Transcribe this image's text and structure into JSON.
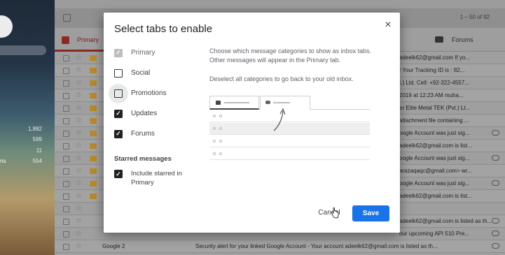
{
  "background": {
    "counts": [
      "1,882",
      "599",
      "11",
      "554"
    ],
    "left_label": "ns",
    "pager": "1 – 50 of 92",
    "tabs": {
      "primary": "Primary",
      "forums": "Forums"
    },
    "rows": [
      {
        "text": "adeelk62@gmail.com If yo..."
      },
      {
        "text": "! Your Tracking ID is : 82..."
      },
      {
        "text": "t.) Ltd. Cell: +92-322-4557..."
      },
      {
        "text": "2019 at 12:23 AM muha..."
      },
      {
        "text": "er Elite Metal TEK (Pvt.) Lt..."
      },
      {
        "text": "attachment file containing ..."
      },
      {
        "text": "oogle Account was just sig..."
      },
      {
        "text": "adeelk62@gmail.com is list..."
      },
      {
        "text": "oogle Account was just sig..."
      },
      {
        "text": "arazaqaqc@gmail.com> wr..."
      },
      {
        "text": "oogle Account was just sig..."
      },
      {
        "text": "adeelk62@gmail.com is list..."
      },
      {
        "text": ""
      },
      {
        "text": "adeelk62@gmail.com is listed as th..."
      },
      {
        "text": "our upcoming API 510 Pre..."
      },
      {
        "sender": "Google 2",
        "text": "Security alert for your linked Google Account - Your account adeelk62@gmail.com is listed as th..."
      },
      {
        "sender": "Google",
        "text": "Security alert - New device signed in to adeelk62@gmail.com Your Google Account was just sig..."
      }
    ]
  },
  "dialog": {
    "title": "Select tabs to enable",
    "close_label": "×",
    "options": [
      {
        "label": "Primary",
        "state": "disabled-checked"
      },
      {
        "label": "Social",
        "state": "unchecked"
      },
      {
        "label": "Promotions",
        "state": "focused-unchecked"
      },
      {
        "label": "Updates",
        "state": "checked"
      },
      {
        "label": "Forums",
        "state": "checked"
      }
    ],
    "starred_heading": "Starred messages",
    "starred_option": {
      "label": "Include starred in Primary",
      "checked": true
    },
    "description_1": "Choose which message categories to show as inbox tabs. Other messages will appear in the Primary tab.",
    "description_2": "Deselect all categories to go back to your old inbox.",
    "cancel_label": "Cancel",
    "save_label": "Save",
    "checkmark": "✓"
  },
  "colors": {
    "primary_button": "#1a73e8",
    "primary_tab_accent": "#8a2a22"
  }
}
